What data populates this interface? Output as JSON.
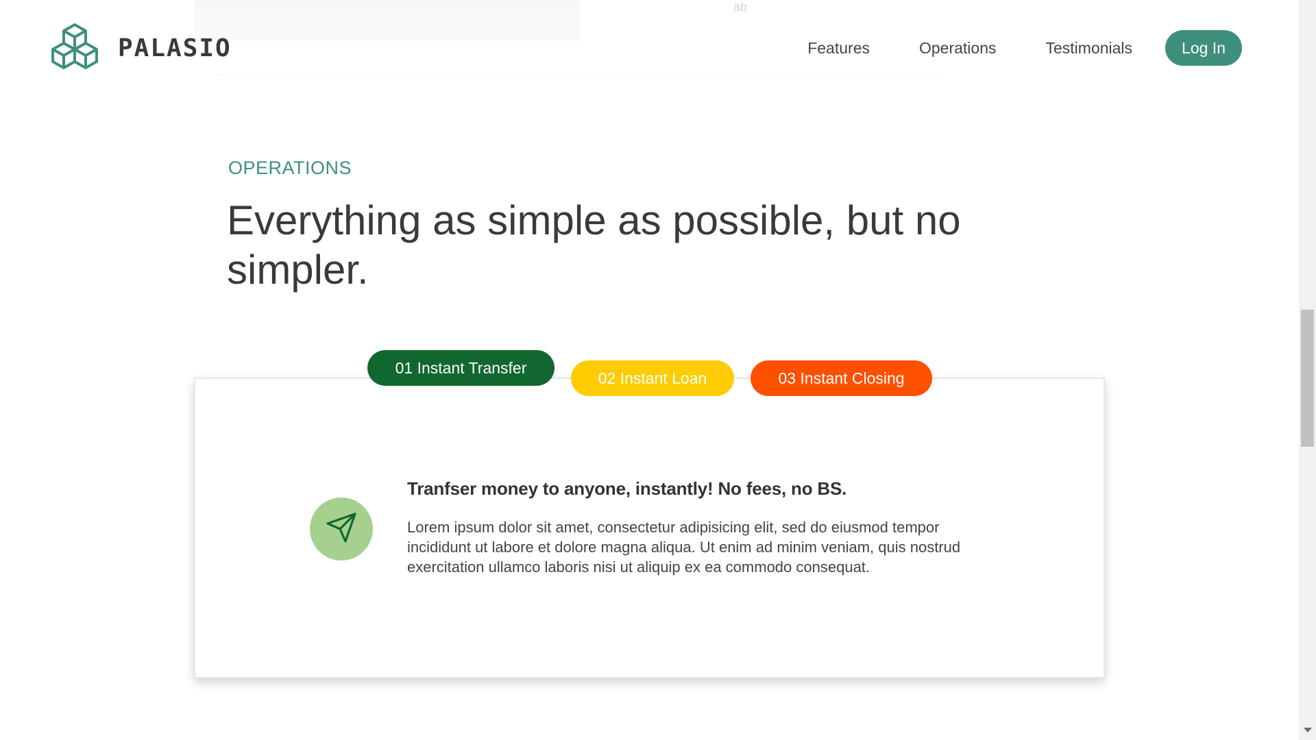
{
  "background_remnant": "ab",
  "brand": {
    "name": "PALASIO",
    "logo_icon": "cubes-icon",
    "accent_color": "#3f8f7d"
  },
  "nav": {
    "links": [
      "Features",
      "Operations",
      "Testimonials"
    ],
    "login_label": "Log In"
  },
  "section": {
    "label": "OPERATIONS",
    "title": "Everything as simple as possible, but no simpler."
  },
  "operations": {
    "tabs": [
      {
        "label": "01 Instant Transfer",
        "color": "#11672f",
        "active": true
      },
      {
        "label": "02 Instant Loan",
        "color": "#ffcb03",
        "active": false
      },
      {
        "label": "03 Instant Closing",
        "color": "#ff5000",
        "active": false
      }
    ],
    "active_content": {
      "icon": "paper-plane-icon",
      "icon_bg": "#a6d08e",
      "heading": "Tranfser money to anyone, instantly! No fees, no BS.",
      "text": "Lorem ipsum dolor sit amet, consectetur adipisicing elit, sed do eiusmod tempor incididunt ut labore et dolore magna aliqua. Ut enim ad minim veniam, quis nostrud exercitation ullamco laboris nisi ut aliquip ex ea commodo consequat."
    }
  }
}
